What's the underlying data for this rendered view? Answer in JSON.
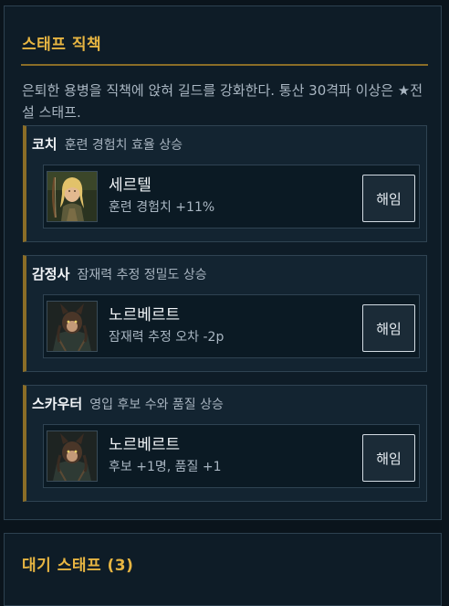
{
  "staff_panel": {
    "title": "스태프 직책",
    "description": "은퇴한 용병을 직책에 앉혀 길드를 강화한다. 통산 30격파 이상은 ★전설 스태프.",
    "roles": [
      {
        "name": "코치",
        "effect": "훈련 경험치 효율 상승",
        "assignee": {
          "name": "세르텔",
          "stat": "훈련 경험치 +11%",
          "portrait": "blonde-archer-portrait"
        },
        "button_label": "해임"
      },
      {
        "name": "감정사",
        "effect": "잠재력 추정 정밀도 상승",
        "assignee": {
          "name": "노르베르트",
          "stat": "잠재력 추정 오차 -2p",
          "portrait": "beast-warrior-portrait"
        },
        "button_label": "해임"
      },
      {
        "name": "스카우터",
        "effect": "영입 후보 수와 품질 상승",
        "assignee": {
          "name": "노르베르트",
          "stat": "후보 +1명, 품질 +1",
          "portrait": "beast-warrior-portrait"
        },
        "button_label": "해임"
      }
    ]
  },
  "waiting_panel": {
    "title": "대기 스태프 (3)"
  },
  "colors": {
    "background": "#0a141c",
    "panel": "#0e1c27",
    "gold_accent": "#e7b542",
    "gold_rule": "#8a6d27",
    "text_primary": "#f2f5f8",
    "text_secondary": "#a9b6c2"
  }
}
